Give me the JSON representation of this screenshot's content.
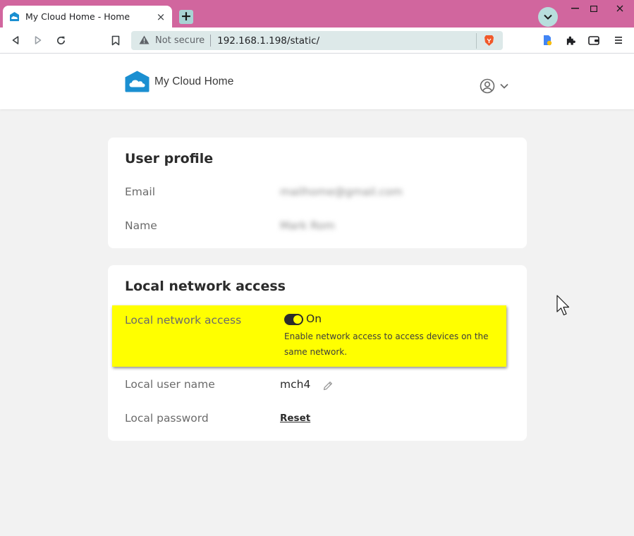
{
  "browser": {
    "tab": {
      "title": "My Cloud Home - Home",
      "close": "×"
    },
    "new_tab": "+",
    "window_controls": {
      "minimize": "—",
      "maximize": "□",
      "close": "✕"
    },
    "address": {
      "security_label": "Not secure",
      "url": "192.168.1.198/static/"
    },
    "icons": [
      "back-icon",
      "forward-icon",
      "reload-icon",
      "bookmark-icon",
      "warning-icon",
      "brave-shield-icon",
      "file-icon",
      "extensions-icon",
      "wallet-icon",
      "menu-icon"
    ]
  },
  "header": {
    "brand": "My Cloud Home"
  },
  "user_profile": {
    "title": "User profile",
    "email_label": "Email",
    "email_value": "mailhome@gmail.com",
    "name_label": "Name",
    "name_value": "Mark Rom"
  },
  "local_network": {
    "title": "Local network access",
    "access_label": "Local network access",
    "toggle_state": "On",
    "toggle_on": true,
    "description": "Enable network access to access devices on the same network.",
    "user_label": "Local user name",
    "user_value": "mch4",
    "password_label": "Local password",
    "reset_label": "Reset"
  },
  "colors": {
    "tabbar": "#d1669e",
    "brand_blue": "#1b8fd1",
    "highlight": "#ffff00",
    "page_bg": "#f2f2f2"
  }
}
